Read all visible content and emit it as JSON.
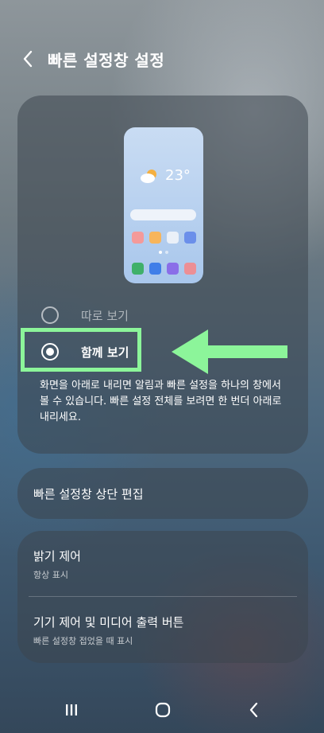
{
  "header": {
    "title": "빠른 설정창 설정",
    "back_icon": "chevron-left-icon"
  },
  "preview": {
    "temperature": "23°",
    "weather_icon": "sun-cloud-icon",
    "app_row_1": [
      "#f49a9a",
      "#f7b55b",
      "#eaf0f8",
      "#6b8fea"
    ],
    "app_row_2": [
      "#3fb06a",
      "#3f7ee8",
      "#8a6ee8",
      "#ec8f95"
    ]
  },
  "options": {
    "separate": {
      "label": "따로 보기",
      "selected": false
    },
    "together": {
      "label": "함께 보기",
      "selected": true
    }
  },
  "description": "화면을 아래로 내리면 알림과 빠른 설정을 하나의 창에서 볼 수 있습니다. 빠른 설정 전체를 보려면 한 번더 아래로 내리세요.",
  "annotation": {
    "highlight_color": "#8cf59a",
    "arrow_color": "#8cf59a"
  },
  "edit_row": {
    "label": "빠른 설정창 상단 편집"
  },
  "controls": {
    "brightness": {
      "title": "밝기 제어",
      "subtitle": "항상 표시"
    },
    "device_media": {
      "title": "기기 제어 및 미디어 출력 버튼",
      "subtitle": "빠른 설정창 접었을 때 표시"
    }
  },
  "navbar": {
    "recents_icon": "recents-icon",
    "home_icon": "home-icon",
    "back_icon": "back-icon"
  }
}
